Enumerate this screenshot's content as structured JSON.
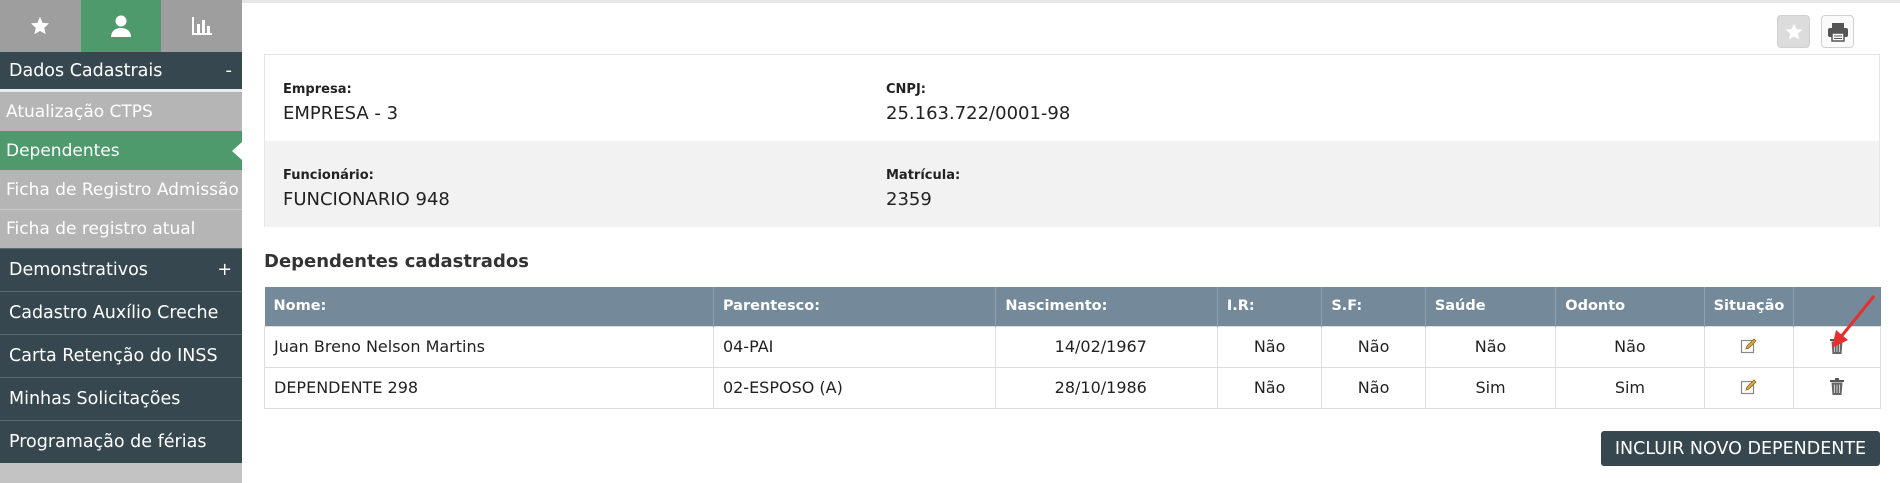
{
  "sidebar": {
    "tabs": [
      {
        "name": "star-icon"
      },
      {
        "name": "user-icon"
      },
      {
        "name": "bar-chart-icon"
      }
    ],
    "section_head": {
      "label": "Dados Cadastrais",
      "sign": "-"
    },
    "sub_items": [
      {
        "label": "Atualização CTPS"
      },
      {
        "label": "Dependentes"
      },
      {
        "label": "Ficha de Registro Admissão"
      },
      {
        "label": "Ficha de registro atual"
      }
    ],
    "menu_items": [
      {
        "label": "Demonstrativos",
        "sign": "+"
      },
      {
        "label": "Cadastro Auxílio Creche",
        "sign": ""
      },
      {
        "label": "Carta Retenção do INSS",
        "sign": ""
      },
      {
        "label": "Minhas Solicitações",
        "sign": ""
      },
      {
        "label": "Programação de férias",
        "sign": ""
      }
    ]
  },
  "info": {
    "empresa_label": "Empresa:",
    "empresa_value": "EMPRESA - 3",
    "cnpj_label": "CNPJ:",
    "cnpj_value": "25.163.722/0001-98",
    "funcionario_label": "Funcionário:",
    "funcionario_value": "FUNCIONARIO 948",
    "matricula_label": "Matrícula:",
    "matricula_value": "2359"
  },
  "section_title": "Dependentes cadastrados",
  "table": {
    "headers": [
      "Nome:",
      "Parentesco:",
      "Nascimento:",
      "I.R:",
      "S.F:",
      "Saúde",
      "Odonto",
      "Situação",
      ""
    ],
    "rows": [
      {
        "nome": "Juan Breno Nelson Martins",
        "parentesco": "04-PAI",
        "nascimento": "14/02/1967",
        "ir": "Não",
        "sf": "Não",
        "saude": "Não",
        "odonto": "Não"
      },
      {
        "nome": "DEPENDENTE 298",
        "parentesco": "02-ESPOSO (A)",
        "nascimento": "28/10/1986",
        "ir": "Não",
        "sf": "Não",
        "saude": "Sim",
        "odonto": "Sim"
      }
    ]
  },
  "add_button": "INCLUIR NOVO DEPENDENTE",
  "colors": {
    "sidebar_dark": "#37474f",
    "sidebar_active": "#4e9a6c",
    "table_header": "#748a9a",
    "annotation_arrow": "#e53030"
  }
}
